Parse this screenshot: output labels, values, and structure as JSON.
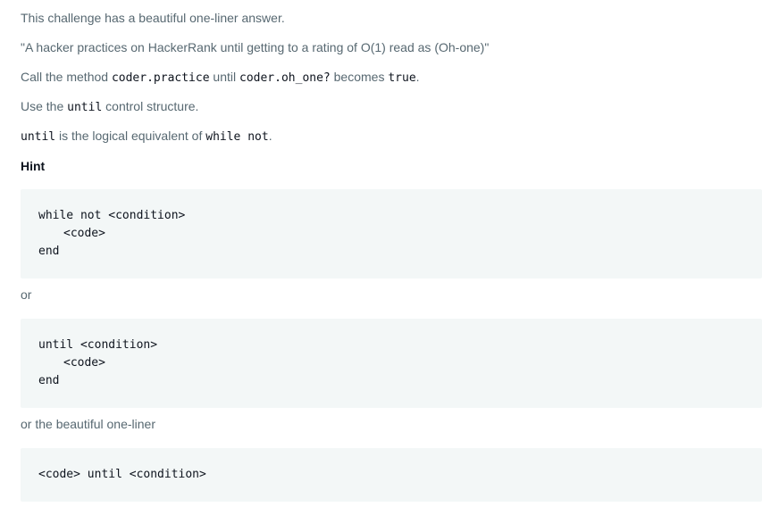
{
  "paragraphs": {
    "p1": "This challenge has a beautiful one-liner answer.",
    "p2": "\"A hacker practices on HackerRank until getting to a rating of O(1) read as (Oh-one)\"",
    "p3": {
      "before": "Call the method ",
      "code1": "coder.practice",
      "mid1": " until ",
      "code2": "coder.oh_one?",
      "mid2": " becomes ",
      "code3": "true",
      "after": "."
    },
    "p4": {
      "before": "Use the ",
      "code": "until",
      "after": " control structure."
    },
    "p5": {
      "code1": "until",
      "mid": " is the logical equivalent of ",
      "code2": "while not",
      "after": "."
    }
  },
  "hint": "Hint",
  "block1": {
    "line1": "while not <condition>",
    "line2": "<code>",
    "line3": "end"
  },
  "or1": "or",
  "block2": {
    "line1": "until <condition>",
    "line2": "<code>",
    "line3": "end"
  },
  "or2": "or the beautiful one-liner",
  "block3": {
    "line1": "<code> until <condition>"
  }
}
